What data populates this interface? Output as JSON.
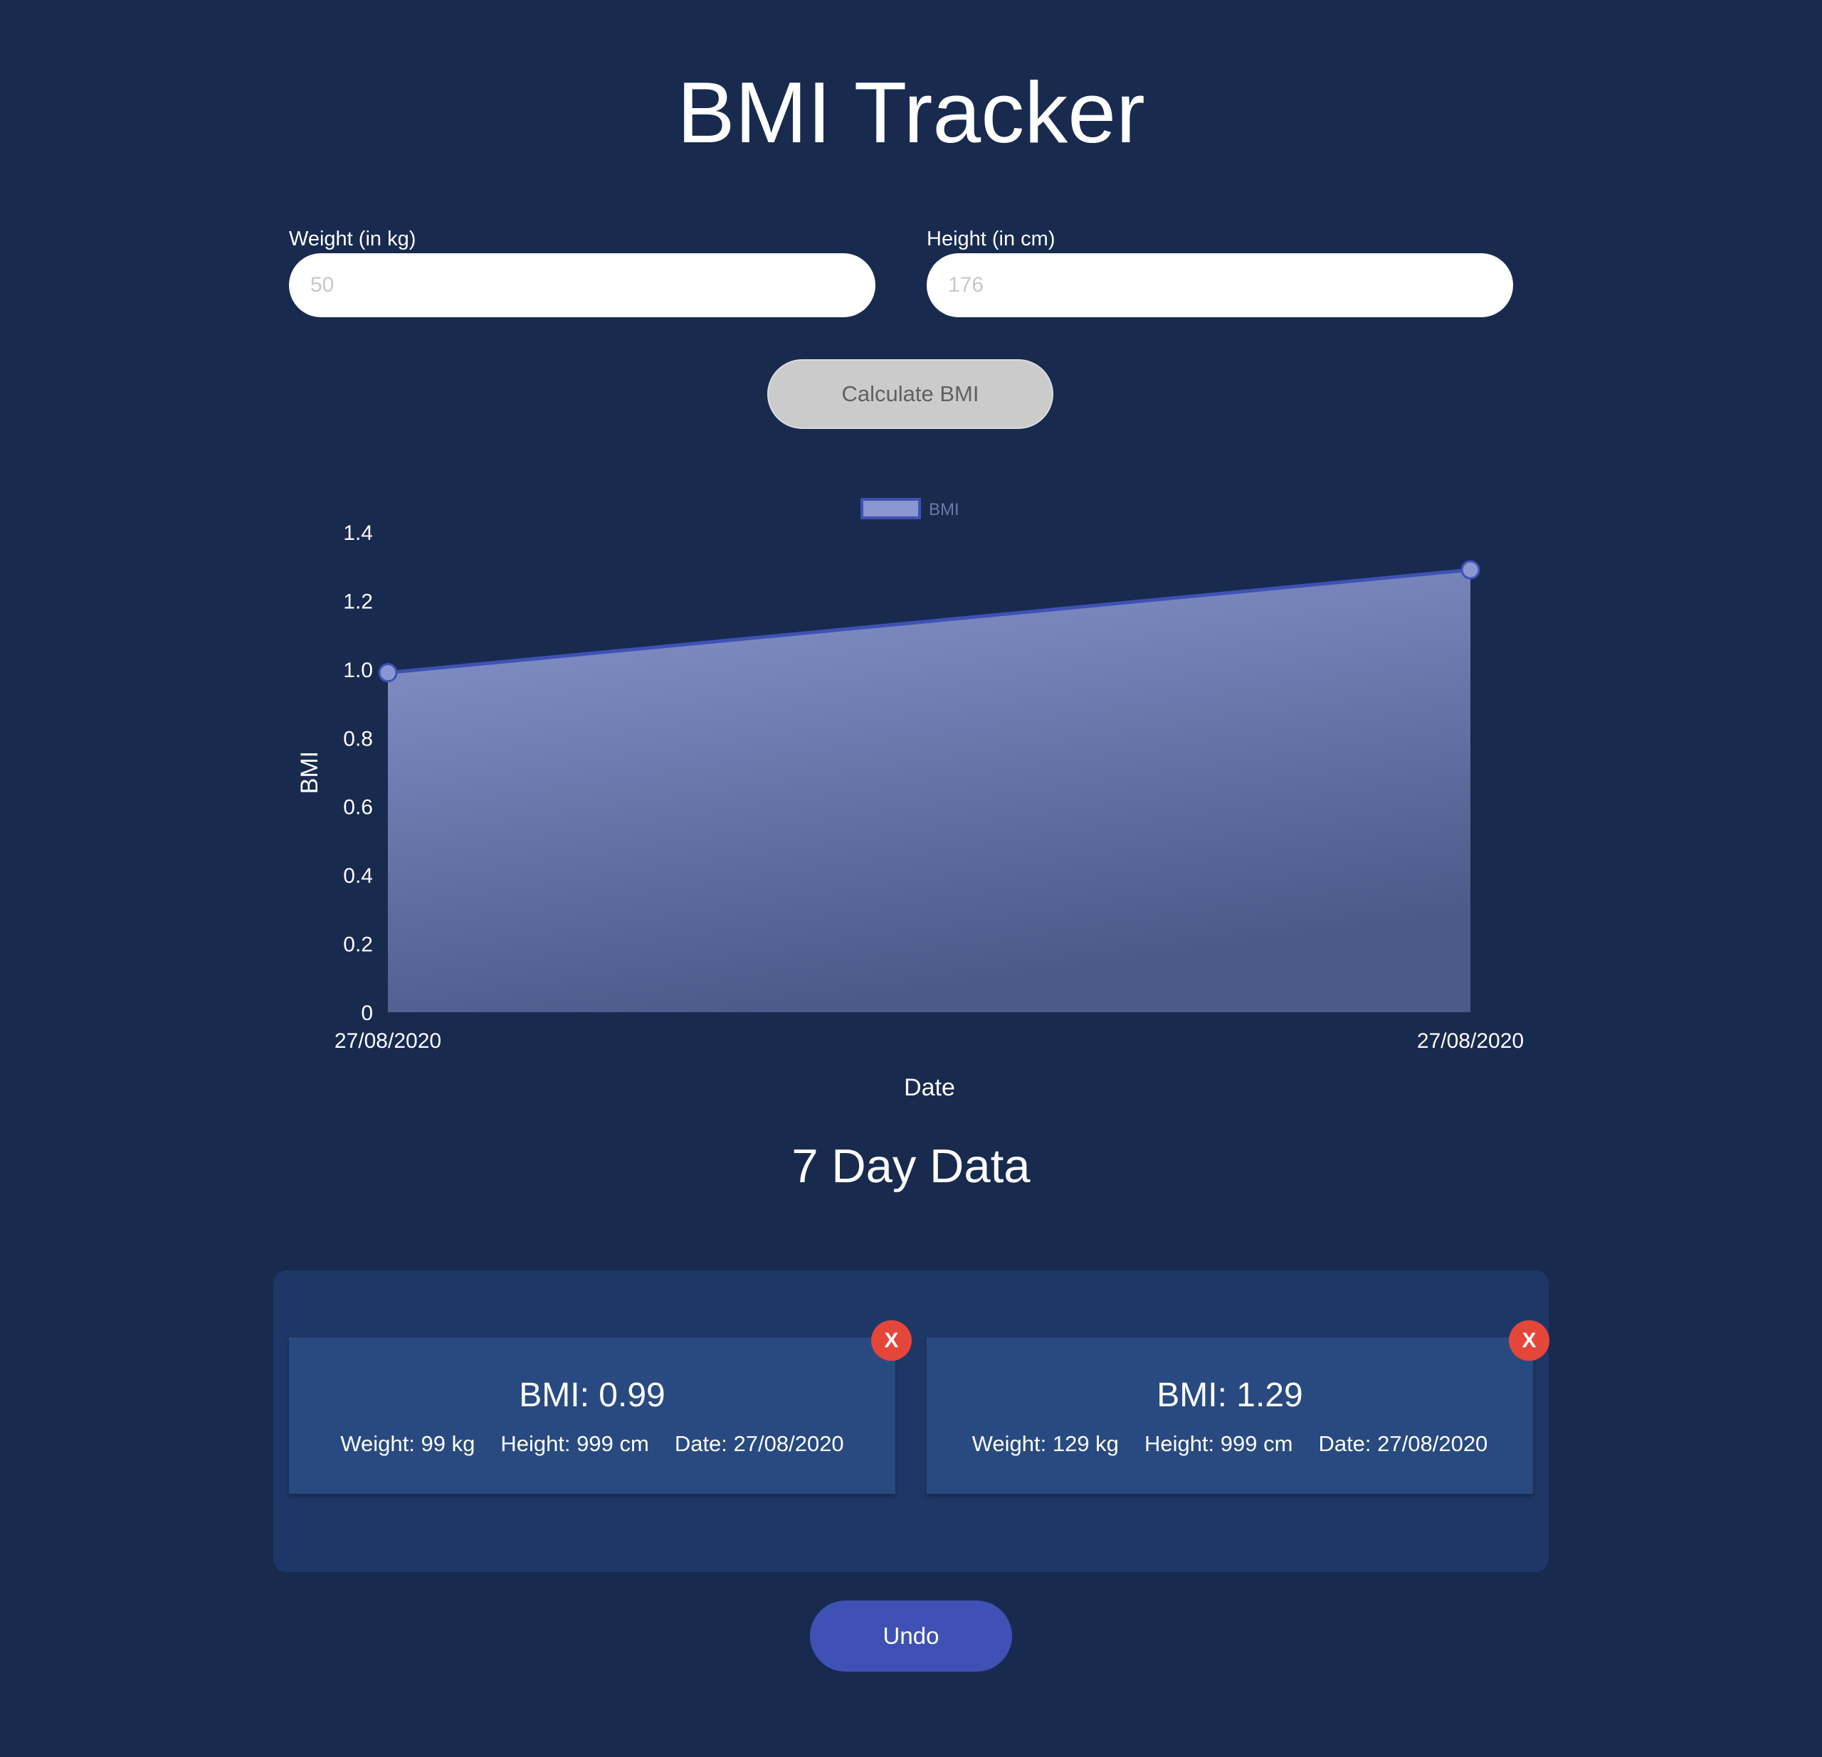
{
  "app": {
    "title": "BMI Tracker"
  },
  "form": {
    "weight": {
      "label": "Weight (in kg)",
      "placeholder": "50",
      "value": ""
    },
    "height": {
      "label": "Height (in cm)",
      "placeholder": "176",
      "value": ""
    },
    "calculate_label": "Calculate BMI"
  },
  "chart_data": {
    "type": "area",
    "x": [
      "27/08/2020",
      "27/08/2020"
    ],
    "series": [
      {
        "name": "BMI",
        "values": [
          0.99,
          1.29
        ]
      }
    ],
    "xlabel": "Date",
    "ylabel": "BMI",
    "ylim": [
      0,
      1.4
    ],
    "yticks": [
      "0",
      "0.2",
      "0.4",
      "0.6",
      "0.8",
      "1.0",
      "1.2",
      "1.4"
    ],
    "legend": "top-center",
    "grid": false,
    "colors": {
      "line": "#3f51b5",
      "fill_top": "#8a97d0",
      "fill_bottom": "#4a5a89",
      "point": "#8a97d0"
    }
  },
  "history": {
    "title": "7 Day Data",
    "entries": [
      {
        "bmi": "BMI: 0.99",
        "weight": "Weight: 99 kg",
        "height": "Height: 999 cm",
        "date": "Date: 27/08/2020",
        "close": "X"
      },
      {
        "bmi": "BMI: 1.29",
        "weight": "Weight: 129 kg",
        "height": "Height: 999 cm",
        "date": "Date: 27/08/2020",
        "close": "X"
      }
    ]
  },
  "undo_label": "Undo",
  "colors": {
    "background": "#182a4e",
    "panel": "#1f3766",
    "card": "#284a80",
    "accent": "#3f51b5",
    "danger": "#e5463a"
  }
}
